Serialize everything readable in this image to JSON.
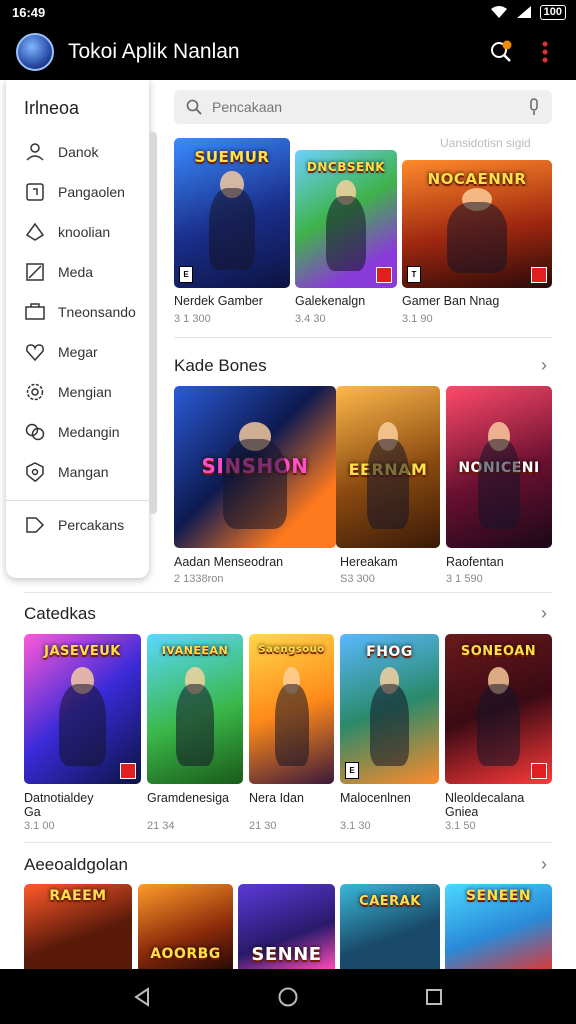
{
  "status": {
    "time": "16:49",
    "battery": "100"
  },
  "app": {
    "title": "Tokoi Aplik Nanlan"
  },
  "colors": {
    "appbar": "#000000",
    "notif_dot": "#f08a00",
    "menu_dot": "#e0302a"
  },
  "drawer": {
    "title": "Irlneoa",
    "items": [
      {
        "label": "Danok",
        "icon": "person-icon"
      },
      {
        "label": "Pangaolen",
        "icon": "square-icon"
      },
      {
        "label": "knoolian",
        "icon": "tag-icon"
      },
      {
        "label": "Meda",
        "icon": "slash-box-icon"
      },
      {
        "label": "Tneonsando",
        "icon": "box-icon"
      },
      {
        "label": "Megar",
        "icon": "heart-icon"
      },
      {
        "label": "Mengian",
        "icon": "gear-icon"
      },
      {
        "label": "Medangin",
        "icon": "chat-icon"
      },
      {
        "label": "Mangan",
        "icon": "shield-icon"
      },
      {
        "label": "Percakans",
        "icon": "tag-outline-icon"
      }
    ]
  },
  "search": {
    "placeholder": "Pencakaan"
  },
  "top_row": {
    "header": "Uansidotisn sigid",
    "apps": [
      {
        "art": "SUEMUR",
        "name": "Nerdek Gamber",
        "meta": "3 1 300"
      },
      {
        "art": "DNCBSENK",
        "name": "Galekenalgn",
        "meta": "3.4 30"
      },
      {
        "art": "NOCAENNR",
        "name": "Gamer Ban Nnag",
        "meta": "3.1 90"
      }
    ]
  },
  "section_kade": {
    "title": "Kade Bones",
    "apps": [
      {
        "art": "SINSHON",
        "name": "Aadan Menseodran",
        "meta": "2 1338ron"
      },
      {
        "art": "EERNAM",
        "name": "Hereakam",
        "meta": "S3 300"
      },
      {
        "art": "NONICENI",
        "name": "Raofentan",
        "meta": "3 1 590"
      }
    ]
  },
  "section_cate": {
    "title": "Catedkas",
    "apps": [
      {
        "art": "JASEVEUK",
        "name": "Datnotialdey",
        "name2": "Ga",
        "meta": "3.1 00"
      },
      {
        "art": "IVANEEAN",
        "name": "Gramdenesiga",
        "meta": "21 34"
      },
      {
        "art": "Saengsouo",
        "name": "Nera Idan",
        "meta": "21 30"
      },
      {
        "art": "FHOG",
        "name": "Malocenlnen",
        "meta": "3.1 30"
      },
      {
        "art": "SONEOAN",
        "name": "Nleoldecalana",
        "name2": "Gniea",
        "meta": "3.1 50"
      }
    ]
  },
  "section_aoea": {
    "title": "Aeeoaldgolan",
    "apps": [
      {
        "art": "RAEEM"
      },
      {
        "art": "AOORBG"
      },
      {
        "art": "SENNE"
      },
      {
        "art": "CAERAK"
      },
      {
        "art": "SENEEN"
      }
    ]
  }
}
